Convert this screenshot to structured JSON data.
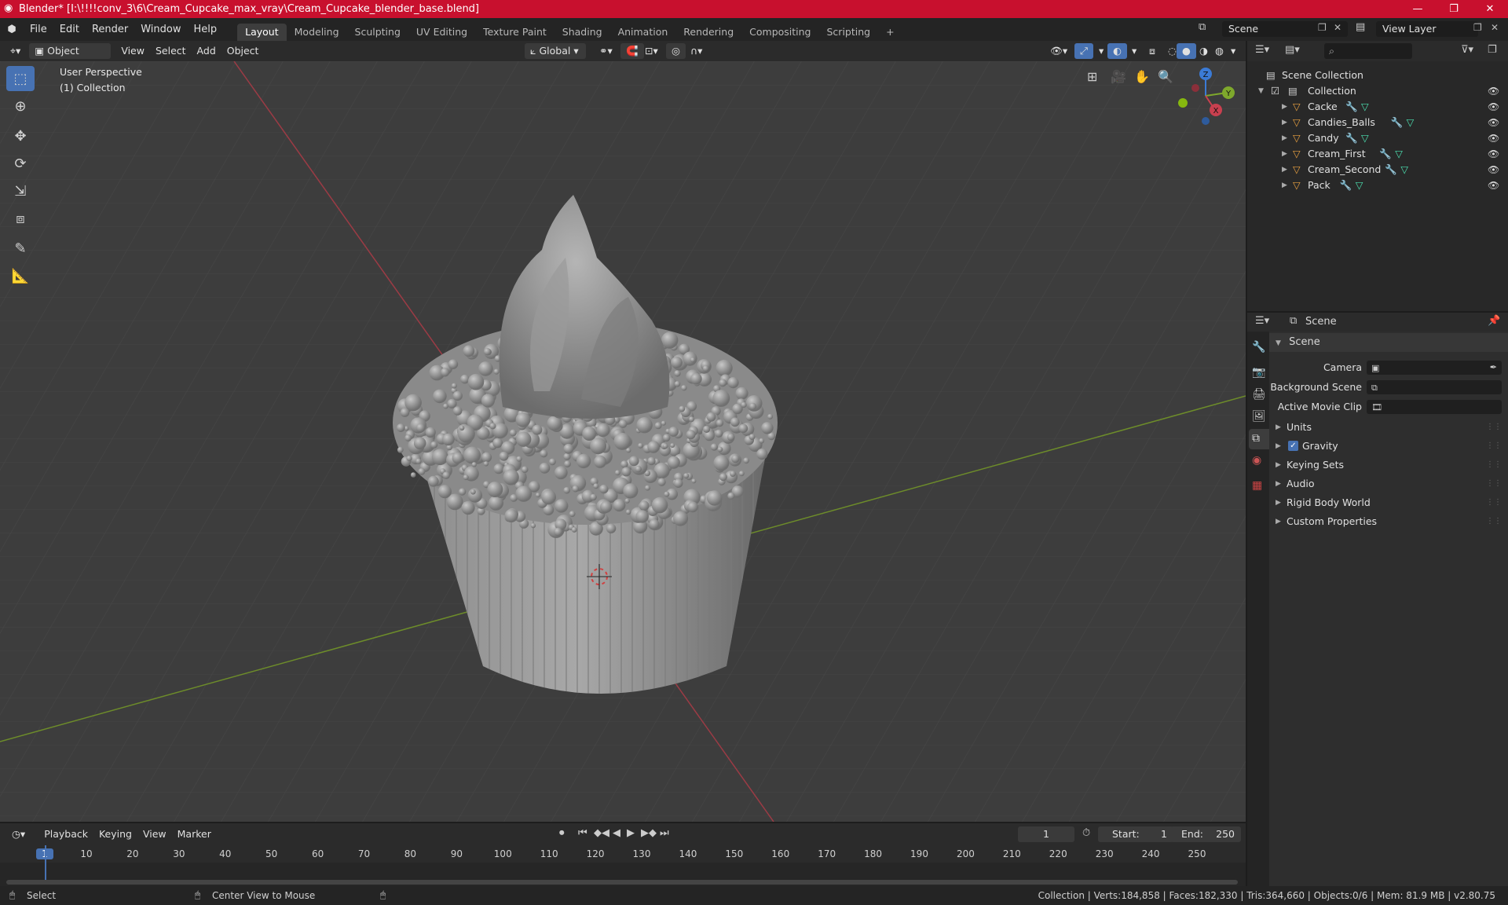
{
  "window": {
    "title": "Blender* [I:\\!!!!conv_3\\6\\Cream_Cupcake_max_vray\\Cream_Cupcake_blender_base.blend]",
    "controls": [
      "—",
      "❐",
      "✕"
    ]
  },
  "menubar": {
    "menus": [
      "File",
      "Edit",
      "Render",
      "Window",
      "Help"
    ],
    "workspaces": [
      "Layout",
      "Modeling",
      "Sculpting",
      "UV Editing",
      "Texture Paint",
      "Shading",
      "Animation",
      "Rendering",
      "Compositing",
      "Scripting"
    ],
    "active_workspace": "Layout",
    "add_tab": "+",
    "scene": "Scene",
    "view_layer": "View Layer"
  },
  "viewport_header": {
    "mode": "Object Mode",
    "menus": [
      "View",
      "Select",
      "Add",
      "Object"
    ],
    "transform_orientation": "Global"
  },
  "viewport": {
    "perspective_label": "User Perspective",
    "collection_label": "(1) Collection",
    "gizmo_axes": [
      "Z",
      "Y",
      "X"
    ],
    "colors": {
      "x_axis": "#c9404f",
      "y_axis": "#7ea82c",
      "z_axis": "#3b7bd6",
      "background": "#3d3d3d",
      "active_tool": "#4772b3"
    }
  },
  "outliner": {
    "root": "Scene Collection",
    "collection": "Collection",
    "objects": [
      {
        "name": "Cacke"
      },
      {
        "name": "Candies_Balls"
      },
      {
        "name": "Candy"
      },
      {
        "name": "Cream_First"
      },
      {
        "name": "Cream_Second"
      },
      {
        "name": "Pack"
      }
    ]
  },
  "properties": {
    "context": "Scene",
    "panel_title": "Scene",
    "fields": [
      {
        "label": "Camera",
        "value": ""
      },
      {
        "label": "Background Scene",
        "value": ""
      },
      {
        "label": "Active Movie Clip",
        "value": ""
      }
    ],
    "sections": [
      {
        "label": "Units",
        "checkbox": false
      },
      {
        "label": "Gravity",
        "checkbox": true
      },
      {
        "label": "Keying Sets",
        "checkbox": false
      },
      {
        "label": "Audio",
        "checkbox": false
      },
      {
        "label": "Rigid Body World",
        "checkbox": false
      },
      {
        "label": "Custom Properties",
        "checkbox": false
      }
    ]
  },
  "timeline": {
    "menus": [
      "Playback",
      "Keying",
      "View",
      "Marker"
    ],
    "current_frame": "1",
    "start_label": "Start:",
    "start": "1",
    "end_label": "End:",
    "end": "250",
    "ruler": [
      "1",
      "10",
      "20",
      "30",
      "40",
      "50",
      "60",
      "70",
      "80",
      "90",
      "100",
      "110",
      "120",
      "130",
      "140",
      "150",
      "160",
      "170",
      "180",
      "190",
      "200",
      "210",
      "220",
      "230",
      "240",
      "250"
    ]
  },
  "statusbar": {
    "select": "Select",
    "center_view": "Center View to Mouse",
    "stats": "Collection | Verts:184,858 | Faces:182,330 | Tris:364,660 | Objects:0/6 | Mem: 81.9 MB | v2.80.75"
  }
}
